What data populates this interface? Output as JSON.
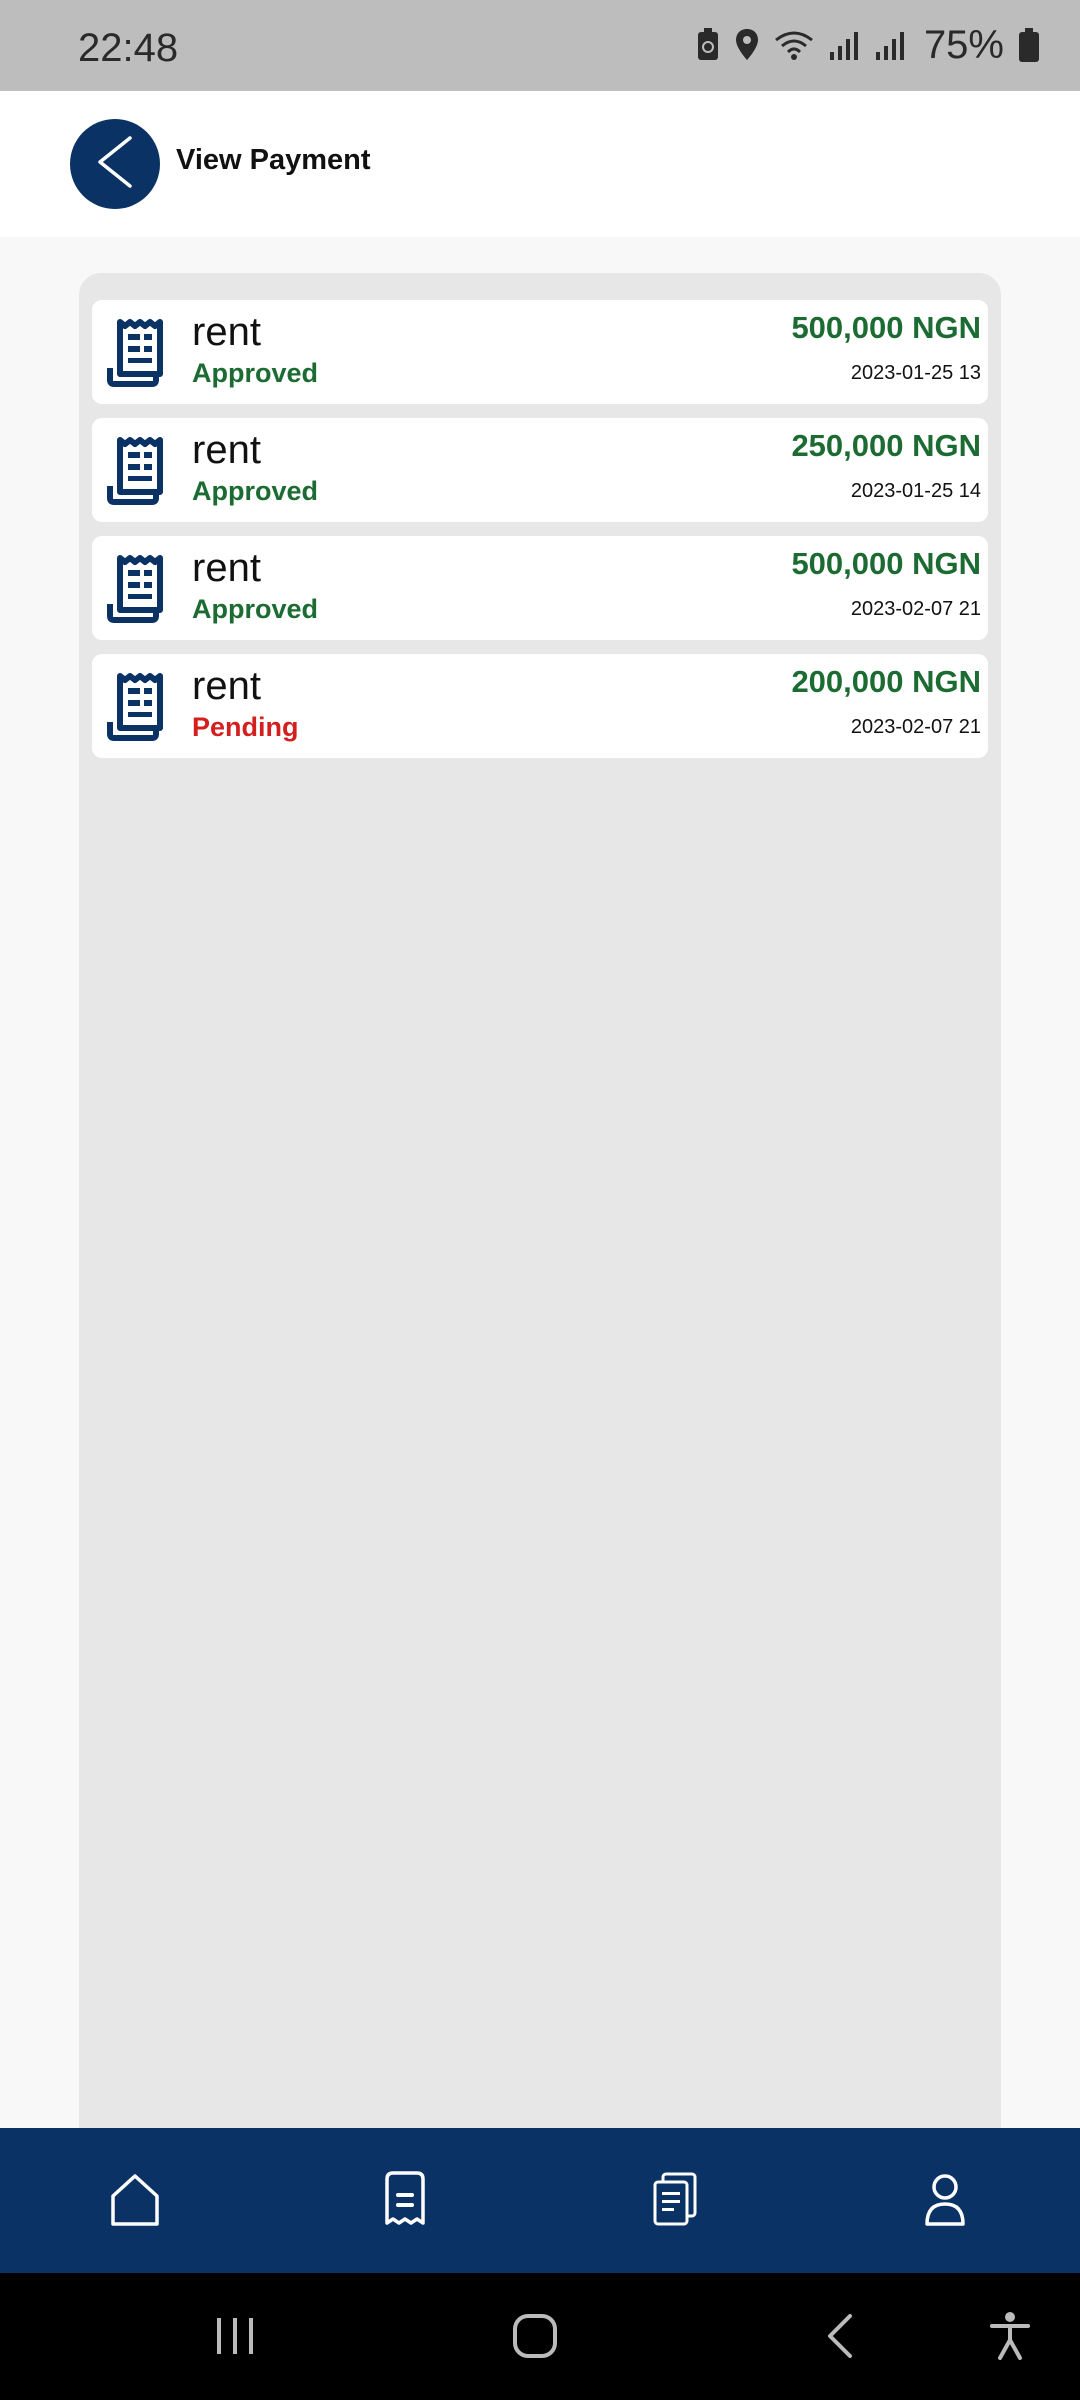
{
  "status_bar": {
    "time": "22:48",
    "battery_percent": "75%",
    "icons": [
      "battery-saver-icon",
      "location-icon",
      "wifi-icon",
      "signal-icon",
      "signal-icon",
      "battery-icon"
    ]
  },
  "header": {
    "title": "View Payment",
    "back_icon": "chevron-left-icon"
  },
  "payments": [
    {
      "title": "rent",
      "status": "Approved",
      "amount": "500,000 NGN",
      "date": "2023-01-25 13"
    },
    {
      "title": "rent",
      "status": "Approved",
      "amount": "250,000 NGN",
      "date": "2023-01-25 14"
    },
    {
      "title": "rent",
      "status": "Approved",
      "amount": "500,000 NGN",
      "date": "2023-02-07 21"
    },
    {
      "title": "rent",
      "status": "Pending",
      "amount": "200,000 NGN",
      "date": "2023-02-07 21"
    }
  ],
  "bottom_nav": {
    "items": [
      "home-icon",
      "receipt-icon",
      "documents-icon",
      "profile-icon"
    ],
    "active": "receipt-icon"
  },
  "system_nav": [
    "recents-icon",
    "home-circle-icon",
    "back-icon",
    "accessibility-icon"
  ],
  "colors": {
    "brand_navy": "#0b3264",
    "approved_green": "#1c6b32",
    "pending_red": "#d41f1f",
    "panel_gray": "#e7e7e7"
  }
}
